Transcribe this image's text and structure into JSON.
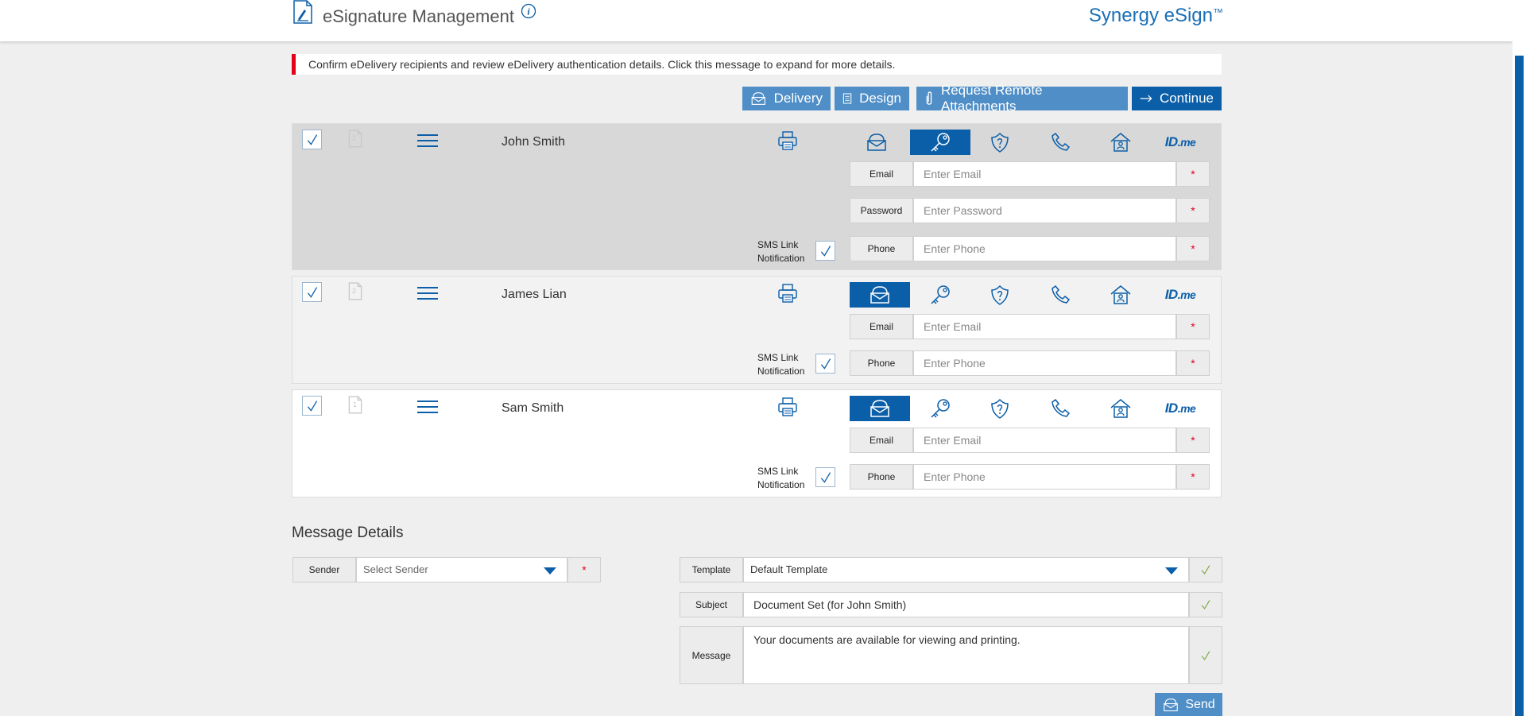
{
  "header": {
    "app_icon": "document-sign-icon",
    "title": "eSignature Management",
    "info_icon": "info-icon",
    "brand": "Synergy eSign",
    "brand_tm": "™"
  },
  "alert": {
    "text": "Confirm eDelivery recipients and review eDelivery authentication details. Click this message to expand for more details.",
    "color": "#e3001b"
  },
  "actions": {
    "delivery": "Delivery",
    "design": "Design",
    "request_attachments": "Request Remote Attachments",
    "continue": "Continue"
  },
  "colors": {
    "primary": "#0b5ea8",
    "button": "#4f8ec6",
    "required": "#e3001b",
    "ok": "#7aa83e"
  },
  "auth_methods": [
    "email-envelope-icon",
    "password-key-icon",
    "security-question-icon",
    "phone-icon",
    "kba-house-icon",
    "id-me-logo"
  ],
  "recipients": [
    {
      "name": "John Smith",
      "order": "2",
      "checked": true,
      "active_method": "password",
      "fields": {
        "email_label": "Email",
        "email_placeholder": "Enter Email",
        "password_label": "Password",
        "password_placeholder": "Enter Password",
        "phone_label": "Phone",
        "phone_placeholder": "Enter Phone",
        "required": "*"
      },
      "sms_label_1": "SMS Link",
      "sms_label_2": "Notification",
      "sms_checked": true
    },
    {
      "name": "James Lian",
      "order": "2",
      "checked": true,
      "active_method": "email",
      "fields": {
        "email_label": "Email",
        "email_placeholder": "Enter Email",
        "phone_label": "Phone",
        "phone_placeholder": "Enter Phone",
        "required": "*"
      },
      "sms_label_1": "SMS Link",
      "sms_label_2": "Notification",
      "sms_checked": true
    },
    {
      "name": "Sam Smith",
      "order": "1",
      "checked": true,
      "active_method": "email",
      "fields": {
        "email_label": "Email",
        "email_placeholder": "Enter Email",
        "phone_label": "Phone",
        "phone_placeholder": "Enter Phone",
        "required": "*"
      },
      "sms_label_1": "SMS Link",
      "sms_label_2": "Notification",
      "sms_checked": true
    }
  ],
  "idme": {
    "id": "ID",
    "me": ".me"
  },
  "message_details": {
    "title": "Message Details",
    "sender_label": "Sender",
    "sender_value": "Select Sender",
    "sender_required": "*",
    "template_label": "Template",
    "template_value": "Default Template",
    "subject_label": "Subject",
    "subject_value": "Document Set (for John Smith)",
    "message_label": "Message",
    "message_value": "Your documents are available for viewing and printing.",
    "send": "Send"
  }
}
